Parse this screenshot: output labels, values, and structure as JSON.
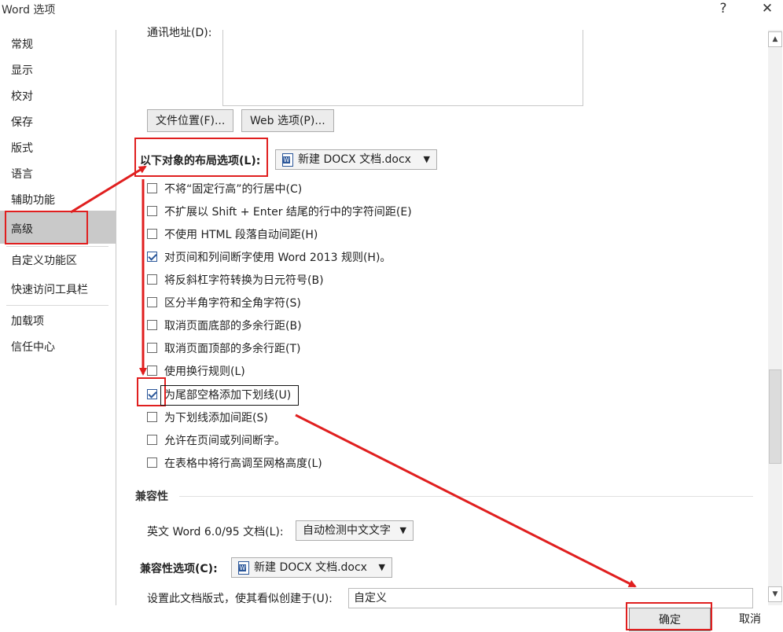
{
  "window": {
    "title": "Word 选项",
    "help_label": "?",
    "close_label": "✕"
  },
  "sidebar": {
    "items": [
      {
        "label": "常规"
      },
      {
        "label": "显示"
      },
      {
        "label": "校对"
      },
      {
        "label": "保存"
      },
      {
        "label": "版式"
      },
      {
        "label": "语言"
      },
      {
        "label": "辅助功能"
      },
      {
        "label": "高级"
      },
      {
        "label": "自定义功能区"
      },
      {
        "label": "快速访问工具栏"
      },
      {
        "label": "加载项"
      },
      {
        "label": "信任中心"
      }
    ],
    "selected": "高级"
  },
  "main": {
    "address_label": "通讯地址(D):",
    "file_locations_button": "文件位置(F)...",
    "web_options_button": "Web 选项(P)...",
    "layout_options_label": "以下对象的布局选项(L):",
    "layout_doc_select": "新建 DOCX 文档.docx",
    "checkboxes": [
      {
        "label": "不将“固定行高”的行居中(C)",
        "checked": false
      },
      {
        "label": "不扩展以 Shift + Enter 结尾的行中的字符间距(E)",
        "checked": false
      },
      {
        "label": "不使用 HTML 段落自动间距(H)",
        "checked": false
      },
      {
        "label": "对页间和列间断字使用 Word 2013 规则(H)。",
        "checked": true
      },
      {
        "label": "将反斜杠字符转换为日元符号(B)",
        "checked": false
      },
      {
        "label": "区分半角字符和全角字符(S)",
        "checked": false
      },
      {
        "label": "取消页面底部的多余行距(B)",
        "checked": false
      },
      {
        "label": "取消页面顶部的多余行距(T)",
        "checked": false
      },
      {
        "label": "使用换行规则(L)",
        "checked": false
      },
      {
        "label": "为尾部空格添加下划线(U)",
        "checked": true
      },
      {
        "label": "为下划线添加间距(S)",
        "checked": false
      },
      {
        "label": "允许在页间或列间断字。",
        "checked": false
      },
      {
        "label": "在表格中将行高调至网格高度(L)",
        "checked": false
      }
    ],
    "compat_section_label": "兼容性",
    "english_word_label": "英文 Word 6.0/95 文档(L):",
    "english_word_select": "自动检测中文文字",
    "compat_options_label": "兼容性选项(C):",
    "compat_doc_select": "新建 DOCX 文档.docx",
    "layout_created_label": "设置此文档版式，使其看似创建于(U):",
    "layout_created_value": "自定义"
  },
  "footer": {
    "ok_label": "确定",
    "cancel_label": "取消"
  },
  "colors": {
    "annotation_red": "#e01f1f",
    "selected_nav_bg": "#c9c9c9",
    "check_blue": "#2b579a"
  }
}
